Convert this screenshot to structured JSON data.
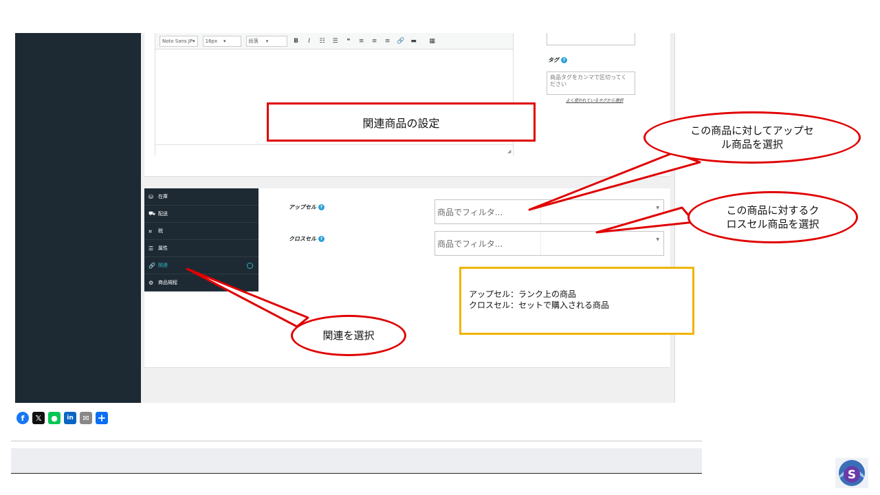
{
  "editor": {
    "font_select": "Noto Sans JP",
    "size_select": "16px",
    "format_select": "段落",
    "buttons": [
      "B",
      "I",
      "☷",
      "☰",
      "❝",
      "≡",
      "≡",
      "≡",
      "🔗",
      "▬",
      "▦"
    ]
  },
  "sidebar_box": {
    "tag_label": "タグ",
    "tag_placeholder": "商品タグをカンマで区切ってください",
    "tag_link": "よく使われているタグから選択"
  },
  "tabs": [
    {
      "label": "在庫",
      "icon": "⛁"
    },
    {
      "label": "配送",
      "icon": "⛟"
    },
    {
      "label": "税",
      "icon": "¤"
    },
    {
      "label": "属性",
      "icon": "☰"
    },
    {
      "label": "関連",
      "icon": "🔗"
    },
    {
      "label": "商品規程",
      "icon": "⚙"
    }
  ],
  "linked": {
    "upsell_label": "アップセル",
    "crosssell_label": "クロスセル",
    "upsell_placeholder": "商品でフィルタ...",
    "crosssell_placeholder": "商品でフィルタ..."
  },
  "annotations": {
    "title_box": "関連商品の設定",
    "upsell_bubble": "この商品に対してアップセル商品を選択",
    "crosssell_bubble": "この商品に対するクロスセル商品を選択",
    "tab_bubble": "関連を選択",
    "note_line1": "アップセル：ランク上の商品",
    "note_line2": "クロスセル：セットで購入される商品"
  },
  "share": [
    {
      "name": "facebook",
      "glyph": "f",
      "color": "#1877f2"
    },
    {
      "name": "x",
      "glyph": "𝕏",
      "color": "#111111"
    },
    {
      "name": "line",
      "glyph": "●",
      "color": "#06c755"
    },
    {
      "name": "linkedin",
      "glyph": "in",
      "color": "#0a66c2"
    },
    {
      "name": "email",
      "glyph": "✉",
      "color": "#888888"
    },
    {
      "name": "more",
      "glyph": "+",
      "color": "#0b6ef5"
    }
  ],
  "logo_letter": "S"
}
